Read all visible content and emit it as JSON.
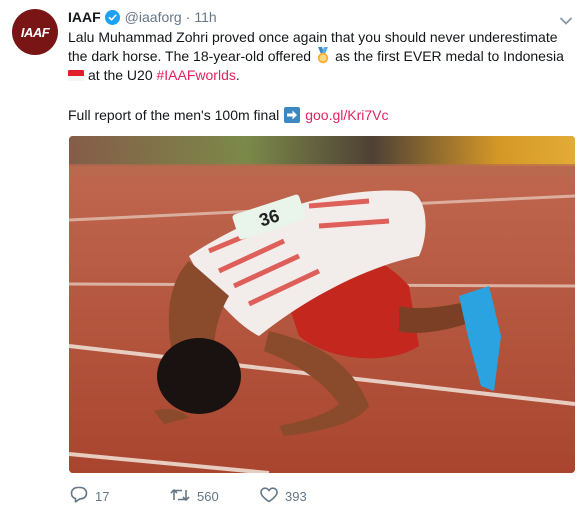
{
  "account": {
    "avatar_text": "IAAF",
    "name": "IAAF",
    "handle": "@iaaforg",
    "separator": "·",
    "time": "11h"
  },
  "tweet": {
    "line1": "Lalu Muhammad Zohri proved once again that you should never underestimate",
    "line2_before": "the dark horse. The 18-year-old offered",
    "line2_after": "as the first EVER medal to Indonesia",
    "line3_text": "at the U20",
    "hashtag": "#IAAFworlds",
    "line3_end": ".",
    "line5_text": "Full report of the men's 100m final",
    "link": "goo.gl/Kri7Vc"
  },
  "icons": {
    "medal": "gold-medal-icon",
    "flag": "indonesia-flag-icon",
    "arrow": "right-arrow-icon",
    "verified": "verified-badge-icon",
    "reply": "reply-icon",
    "retweet": "retweet-icon",
    "like": "heart-icon",
    "menu": "chevron-down-icon"
  },
  "actions": {
    "replies": "17",
    "retweets": "560",
    "likes": "393"
  },
  "colors": {
    "link": "#e0245e",
    "verified": "#1da1f2",
    "avatar": "#7a1515",
    "track": "#b5503e"
  }
}
